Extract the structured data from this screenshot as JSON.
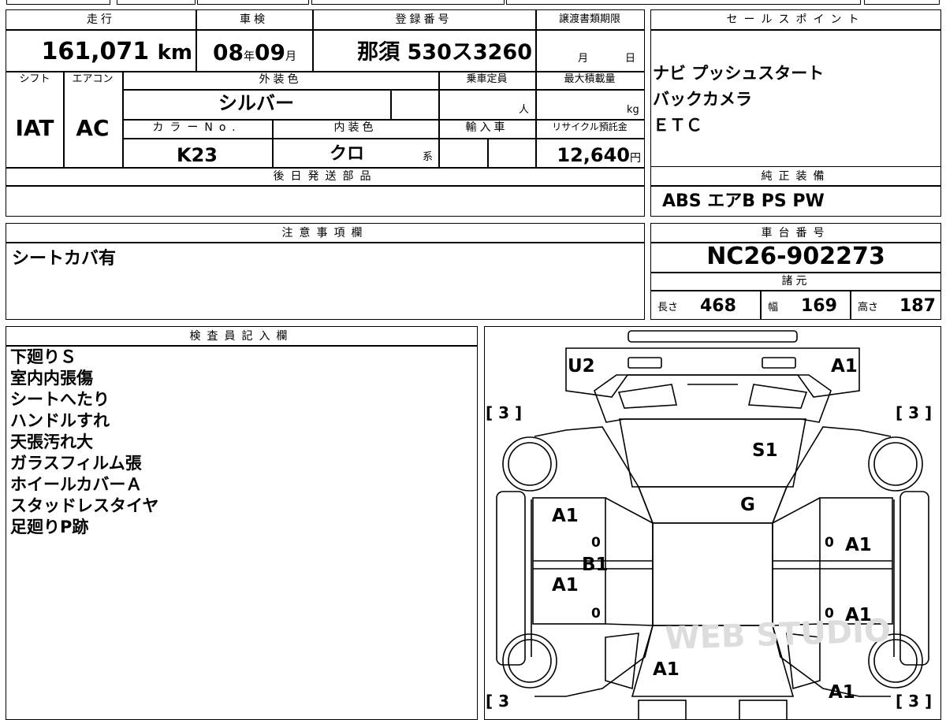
{
  "top_info": {
    "mileage_label": "走行",
    "mileage_value": "161,071",
    "mileage_unit": "km",
    "shaken_label": "車検",
    "shaken_year": "08",
    "shaken_year_unit": "年",
    "shaken_month": "09",
    "shaken_month_unit": "月",
    "reg_label": "登録番号",
    "reg_value": "那須 530ス3260",
    "transfer_label": "譲渡書類期限",
    "transfer_month_unit": "月",
    "transfer_day_unit": "日",
    "shift_label": "シフト",
    "shift_value": "IAT",
    "ac_label": "エアコン",
    "ac_value": "AC",
    "exterior_label": "外装色",
    "exterior_value": "シルバー",
    "capacity_label": "乗車定員",
    "capacity_unit": "人",
    "maxload_label": "最大積載量",
    "maxload_unit": "kg",
    "colorno_label": "カラーNo.",
    "colorno_value": "K23",
    "interior_label": "内装色",
    "interior_value": "クロ",
    "interior_unit": "系",
    "import_label": "輸入車",
    "recycle_label": "リサイクル預託金",
    "recycle_value": "12,640",
    "recycle_unit": "円",
    "later_parts_label": "後日発送部品"
  },
  "sales_points": {
    "label": "セールスポイント",
    "lines": [
      "ナビ プッシュスタート",
      "バックカメラ",
      "ＥＴＣ"
    ]
  },
  "genuine_equipment": {
    "label": "純正装備",
    "value": "ABS エアB PS PW"
  },
  "notes": {
    "label": "注意事項欄",
    "value": "シートカバ有"
  },
  "chassis": {
    "label": "車台番号",
    "value": "NC26-902273"
  },
  "specs": {
    "label": "諸元",
    "length_label": "長さ",
    "length_value": "468",
    "width_label": "幅",
    "width_value": "169",
    "height_label": "高さ",
    "height_value": "187"
  },
  "inspector": {
    "label": "検査員記入欄",
    "lines": [
      "下廻りＳ",
      "室内内張傷",
      "シートへたり",
      "ハンドルすれ",
      "天張汚れ大",
      "ガラスフィルム張",
      "ホイールカバーＡ",
      "スタッドレスタイヤ",
      "足廻りP跡"
    ]
  },
  "diagram": {
    "marks": {
      "front_left": "U2",
      "front_right": "A1",
      "windshield": "S1",
      "glass": "G",
      "left_front_door": "A1",
      "left_rear_door": "A1",
      "left_pillar": "B1",
      "right_front_door": "A1",
      "right_rear_door": "A1",
      "rear_center": "A1",
      "rear_right": "A1",
      "door_zero": "0"
    },
    "tire_labels": {
      "front_left": "[ 3 ]",
      "front_right": "[ 3 ]",
      "rear_left": "[ 3",
      "rear_right": "[ 3 ]"
    },
    "watermark": "WEB STUDIO"
  }
}
